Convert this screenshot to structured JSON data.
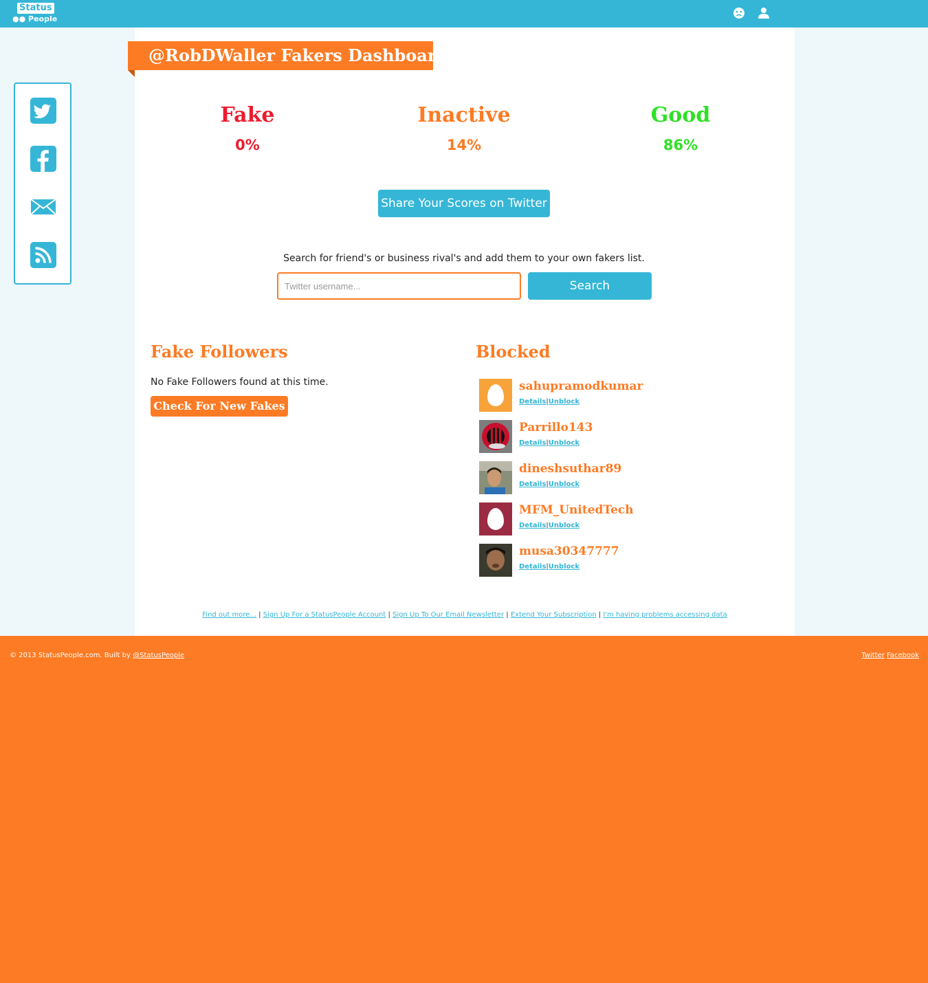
{
  "brand": {
    "line1": "Status",
    "line2": "People"
  },
  "topbar_icons": [
    "frown-face-icon",
    "user-icon"
  ],
  "social_icons": [
    "twitter-icon",
    "facebook-icon",
    "email-icon",
    "rss-icon"
  ],
  "dashboard": {
    "title": "@RobDWaller Fakers Dashboard"
  },
  "stats": [
    {
      "label": "Fake",
      "value": "0%",
      "color": "#ee1c2e"
    },
    {
      "label": "Inactive",
      "value": "14%",
      "color": "#fc7b24"
    },
    {
      "label": "Good",
      "value": "86%",
      "color": "#30e025"
    }
  ],
  "share_button": "Share Your Scores on Twitter",
  "search": {
    "prompt": "Search for friend's or business rival's and add them to your own fakers list.",
    "placeholder": "Twitter username...",
    "button": "Search"
  },
  "fake_followers": {
    "title": "Fake Followers",
    "message": "No Fake Followers found at this time.",
    "button": "Check For New Fakes"
  },
  "blocked": {
    "title": "Blocked",
    "details_label": "Details",
    "unblock_label": "Unblock",
    "separator": "|",
    "items": [
      {
        "name": "sahupramodkumar"
      },
      {
        "name": "Parrillo143"
      },
      {
        "name": "dineshsuthar89"
      },
      {
        "name": "MFM_UnitedTech"
      },
      {
        "name": "musa30347777"
      }
    ]
  },
  "footer_links": {
    "items": [
      "Find out more...",
      "Sign Up For a StatusPeople Account",
      "Sign Up To Our Email Newsletter",
      "Extend Your Subscription",
      "I'm having problems accessing data"
    ],
    "separator": "|"
  },
  "footer": {
    "copyright": "© 2013 StatusPeople.com. Built by ",
    "built_by_link": "@StatusPeople",
    "links": [
      "Twitter",
      "Facebook"
    ]
  },
  "colors": {
    "brand_blue": "#35b6d6",
    "brand_orange": "#fc7b24"
  }
}
